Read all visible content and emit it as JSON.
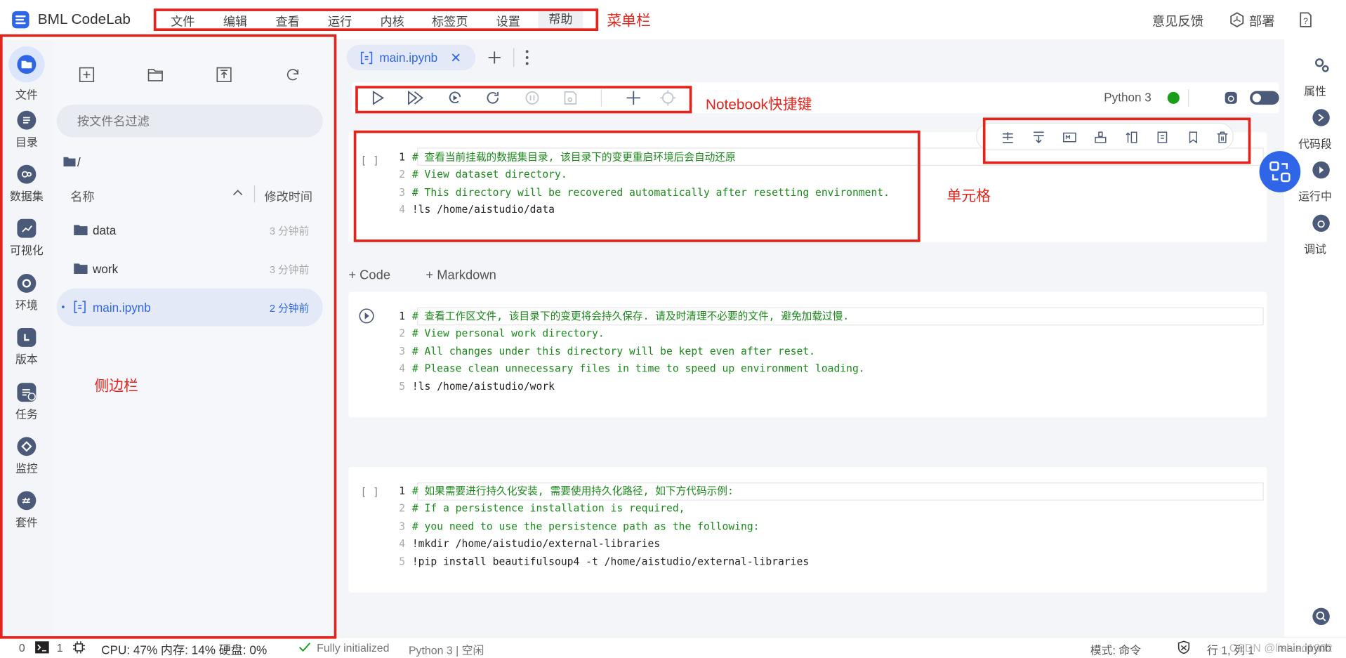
{
  "app": {
    "title": "BML CodeLab",
    "accent": "#2f66e8"
  },
  "menu": {
    "items": [
      "文件",
      "编辑",
      "查看",
      "运行",
      "内核",
      "标签页",
      "设置",
      "帮助"
    ]
  },
  "top_right": {
    "feedback": "意见反馈",
    "deploy": "部署",
    "help_icon": "question-icon"
  },
  "annotations": {
    "menubar": "菜单栏",
    "shortcuts": "Notebook快捷键",
    "cell": "单元格",
    "sidebar": "侧边栏",
    "color": "#e3241c"
  },
  "left_rail": {
    "items": [
      {
        "label": "文件",
        "icon": "folder-icon"
      },
      {
        "label": "目录",
        "icon": "list-icon"
      },
      {
        "label": "数据集",
        "icon": "dataset-icon"
      },
      {
        "label": "可视化",
        "icon": "chart-icon"
      },
      {
        "label": "环境",
        "icon": "environment-icon"
      },
      {
        "label": "版本",
        "icon": "version-icon"
      },
      {
        "label": "任务",
        "icon": "task-icon"
      },
      {
        "label": "监控",
        "icon": "monitor-icon"
      },
      {
        "label": "套件",
        "icon": "kit-icon"
      }
    ]
  },
  "file_panel": {
    "filter_placeholder": "按文件名过滤",
    "path": "/",
    "col_name": "名称",
    "col_time": "修改时间",
    "files": [
      {
        "name": "data",
        "time": "3 分钟前",
        "type": "folder"
      },
      {
        "name": "work",
        "time": "3 分钟前",
        "type": "folder"
      },
      {
        "name": "main.ipynb",
        "time": "2 分钟前",
        "type": "notebook"
      }
    ]
  },
  "tabs": {
    "active": "main.ipynb"
  },
  "toolbar": {
    "kernel": "Python 3",
    "kernel_status_color": "#1a9e1a"
  },
  "cells": [
    {
      "prompt": "[ ]",
      "lines": [
        "# 查看当前挂载的数据集目录, 该目录下的变更重启环境后会自动还原",
        "# View dataset directory.",
        "# This directory will be recovered automatically after resetting environment.",
        "!ls /home/aistudio/data"
      ]
    },
    {
      "prompt": "",
      "lines": [
        "# 查看工作区文件, 该目录下的变更将会持久保存. 请及时清理不必要的文件, 避免加载过慢.",
        "# View personal work directory.",
        "# All changes under this directory will be kept even after reset.",
        "# Please clean unnecessary files in time to speed up environment loading.",
        "!ls /home/aistudio/work"
      ]
    },
    {
      "prompt": "[ ]",
      "lines": [
        "# 如果需要进行持久化安装, 需要使用持久化路径, 如下方代码示例:",
        "# If a persistence installation is required,",
        "# you need to use the persistence path as the following:",
        "!mkdir /home/aistudio/external-libraries",
        "!pip install beautifulsoup4 -t /home/aistudio/external-libraries"
      ]
    }
  ],
  "add_cell": {
    "code": "+ Code",
    "markdown": "+ Markdown"
  },
  "right_rail": {
    "items": [
      "属性",
      "代码段",
      "运行中",
      "调试"
    ]
  },
  "status": {
    "zero": "0",
    "one": "1",
    "cpu": "CPU:  47% 内存:  14% 硬盘:  0%",
    "init": "Fully initialized",
    "kernel": "Python 3 | 空闲",
    "mode": "模式:  命令",
    "pos": "行 1, 列 1",
    "file": "main.ipynb",
    "watermark": "CSDN @liabiao1602"
  }
}
